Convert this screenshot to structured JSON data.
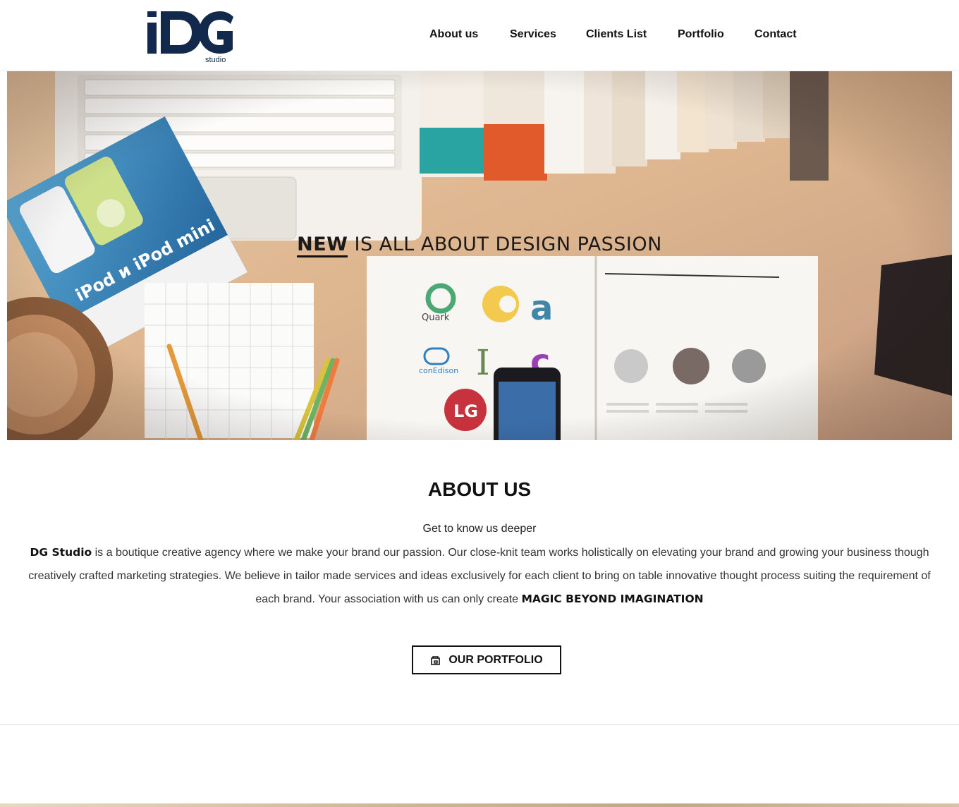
{
  "header": {
    "logo_text": "DG",
    "logo_sub": "studio",
    "nav": [
      {
        "label": "About us"
      },
      {
        "label": "Services"
      },
      {
        "label": "Clients List"
      },
      {
        "label": "Portfolio"
      },
      {
        "label": "Contact"
      }
    ]
  },
  "hero": {
    "title_strong": "NEW",
    "title_rest": " IS ALL ABOUT DESIGN PASSION"
  },
  "about": {
    "title": "ABOUT US",
    "subtitle": "Get to know us deeper",
    "brand": "DG Studio",
    "body": " is a boutique creative agency where we make your brand our passion. Our close-knit team works holistically on elevating your brand and growing your business though creatively crafted marketing strategies. We believe in tailor made services and ideas exclusively for each client to bring on table innovative thought process suiting the requirement of each brand. Your association with us can only create ",
    "highlight": "MAGIC BEYOND IMAGINATION",
    "button_label": "OUR PORTFOLIO"
  },
  "colors": {
    "logo": "#13294b",
    "text": "#111111",
    "divider": "#ececec"
  }
}
